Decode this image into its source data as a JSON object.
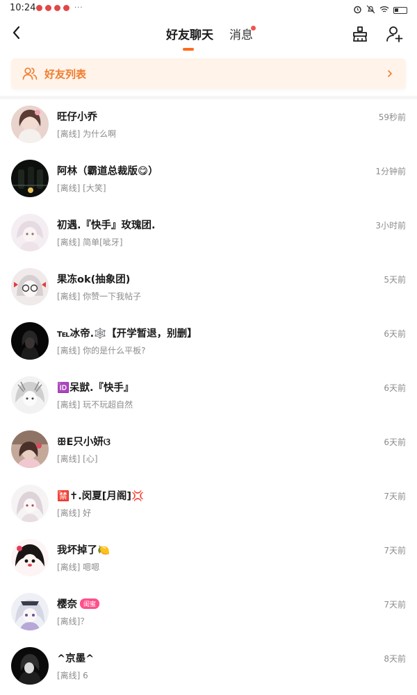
{
  "status_bar": {
    "time": "10:24",
    "notification_count_dots": 4,
    "more": "···",
    "icons": [
      "alarm-icon",
      "mute-icon",
      "wifi-icon",
      "battery-icon"
    ]
  },
  "header": {
    "tabs": [
      {
        "label": "好友聊天",
        "active": true
      },
      {
        "label": "消息",
        "has_dot": true
      }
    ],
    "icons": [
      "back-icon",
      "broom-icon",
      "add-friend-icon"
    ]
  },
  "banner": {
    "label": "好友列表",
    "icon": "friends-icon",
    "accent_color": "#f07d2e"
  },
  "chats": [
    {
      "name": "旺仔小乔",
      "preview": "[离线] 为什么啊",
      "time": "59秒前"
    },
    {
      "name": "阿林（霸道总裁版😋）",
      "preview": "[离线] [大笑]",
      "time": "1分钟前"
    },
    {
      "name": "初遇.『快手』玫瑰团.",
      "preview": "[离线] 简单[呲牙]",
      "time": "3小时前"
    },
    {
      "name": "果冻ok(抽象团)",
      "preview": "[离线] 你赞一下我帖子",
      "time": "5天前"
    },
    {
      "name": "℡冰帝.🕸️【开学暂退，别删】",
      "preview": "[离线] 你的是什么平板?",
      "time": "6天前"
    },
    {
      "name": "🆔呆獃.『快手』",
      "preview": "[离线] 玩不玩超自然",
      "time": "6天前"
    },
    {
      "name": "ꕥE只小妍ଓ",
      "preview": "[离线] [心]",
      "time": "6天前"
    },
    {
      "name": "🈲✝.闵夏[月阁]💢",
      "preview": "[离线] 好",
      "time": "7天前"
    },
    {
      "name": "我坏掉了🍋",
      "preview": "[离线] 嗯嗯",
      "time": "7天前"
    },
    {
      "name": "樱奈",
      "badge": "闺蜜",
      "preview": "[离线]？",
      "time": "7天前"
    },
    {
      "name": "^京墨^",
      "preview": "[离线] 6",
      "time": "8天前"
    }
  ],
  "colors": {
    "accent": "#ff6b1a",
    "badge": "#ff4f8a",
    "muted_text": "#8c8c8c"
  }
}
